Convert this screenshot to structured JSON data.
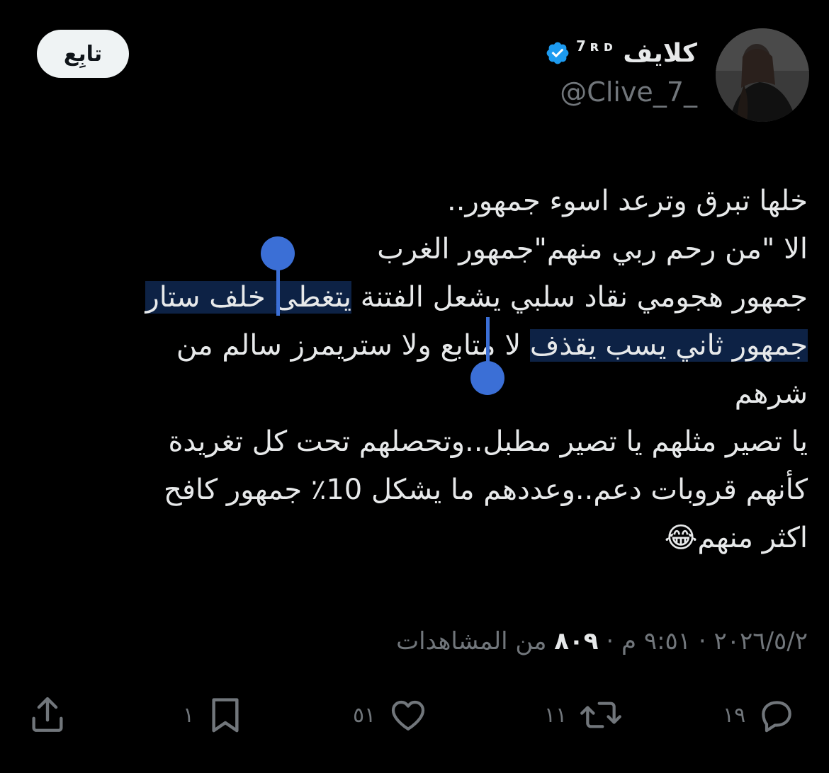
{
  "header": {
    "follow_label": "تابِع",
    "display_name": "كلايف",
    "name_suffix": "7ʀᴅ",
    "handle": "@Clive_7_",
    "verified": true
  },
  "tweet": {
    "lines": {
      "l1": "خلها تبرق وترعد اسوء جمهور..",
      "l2": "الا \"من رحم ربي منهم\"جمهور الغرب",
      "l3_pre": "جمهور هجومي نقاد سلبي يشعل الفتنة ",
      "l3_sel": "يتغطى خلف ستار",
      "l4_sel": "جمهور ثاني يسب يقذف",
      "l4_post": " لا متابع ولا ستريمرز سالم من",
      "l5": "شرهم",
      "l6": "يا تصير مثلهم يا تصير مطبل..وتحصلهم تحت كل تغريدة",
      "l7": "كأنهم قروبات دعم..وعددهم ما يشكل 10٪  جمهور كافح",
      "l8": "اكثر منهم",
      "emoji": "😂"
    }
  },
  "meta": {
    "date": "٢٠٢٦/٥/٢",
    "time": "٩:٥١ م",
    "separator": " · ",
    "views_count": "٨٠٩",
    "views_label": " من المشاهدات"
  },
  "actions": {
    "reply_count": "١٩",
    "repost_count": "١١",
    "like_count": "٥١",
    "bookmark_count": "١"
  },
  "colors": {
    "background": "#000000",
    "text": "#e7e9ea",
    "muted": "#71767b",
    "selection": "#0d2245",
    "selection_handle": "#3b6fd6",
    "verified": "#1d9bf0"
  }
}
